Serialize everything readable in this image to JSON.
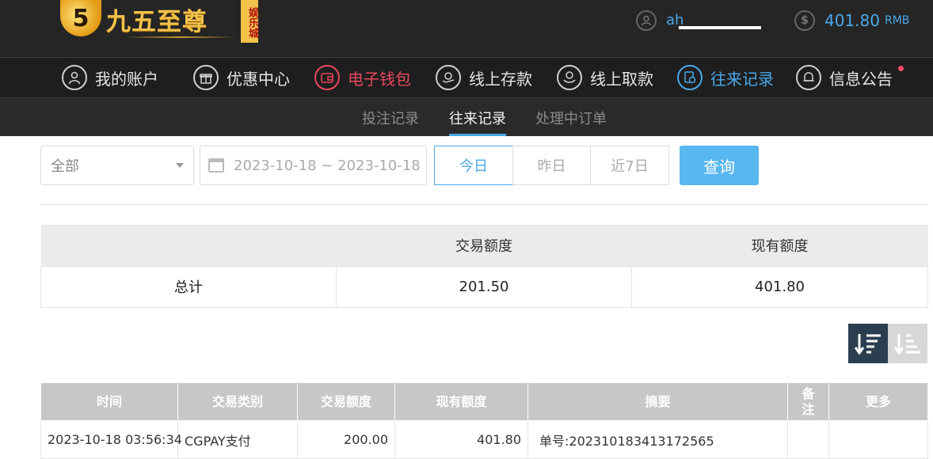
{
  "header": {
    "logo_text": "九五至尊",
    "logo_sub": "娱乐城",
    "username": "ah",
    "balance": "401.80",
    "currency": "RMB"
  },
  "nav": [
    {
      "label": "我的账户",
      "icon": "user-icon"
    },
    {
      "label": "优惠中心",
      "icon": "gift-icon"
    },
    {
      "label": "电子钱包",
      "icon": "wallet-icon"
    },
    {
      "label": "线上存款",
      "icon": "deposit-icon"
    },
    {
      "label": "线上取款",
      "icon": "withdraw-icon"
    },
    {
      "label": "往来记录",
      "icon": "records-icon"
    },
    {
      "label": "信息公告",
      "icon": "bell-icon"
    }
  ],
  "subnav": [
    "投注记录",
    "往来记录",
    "处理中订单"
  ],
  "filter": {
    "type": "全部",
    "date_range": "2023-10-18 ~ 2023-10-18",
    "quick": [
      "今日",
      "昨日",
      "近7日"
    ],
    "query": "查询"
  },
  "summary": {
    "headers": [
      "",
      "交易额度",
      "现有额度"
    ],
    "row_label": "总计",
    "amount": "201.50",
    "balance": "401.80"
  },
  "records": {
    "headers": [
      "时间",
      "交易类别",
      "交易额度",
      "现有额度",
      "摘要",
      "备注",
      "更多"
    ],
    "rows": [
      {
        "time": "2023-10-18 03:56:34",
        "type": "CGPAY支付",
        "amount": "200.00",
        "balance": "401.80",
        "summary": "单号:202310183413172565",
        "note": "",
        "more": ""
      }
    ]
  },
  "colors": {
    "accent_blue": "#4aa8e8",
    "accent_red": "#e8475e",
    "header_bg": "#252525"
  }
}
